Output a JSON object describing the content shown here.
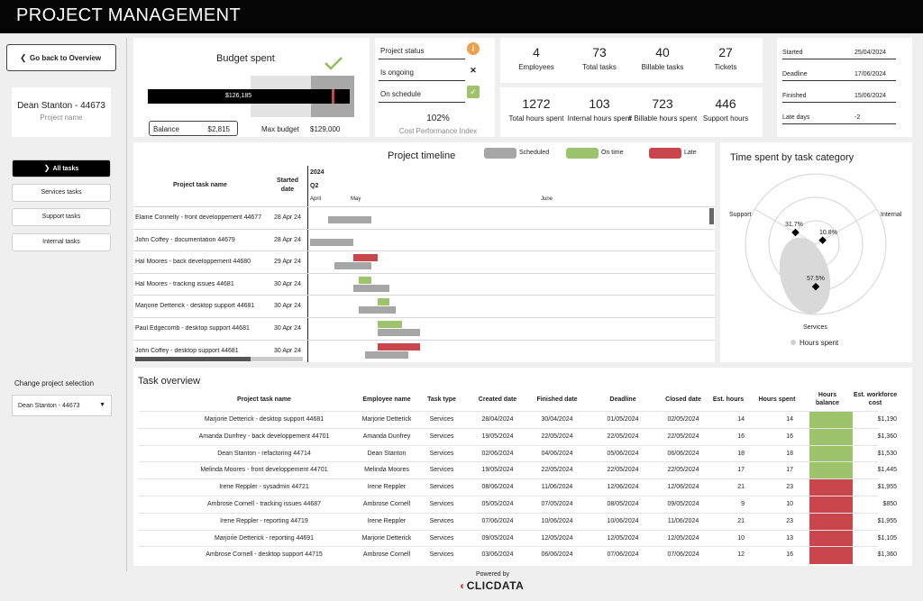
{
  "header": {
    "title": "PROJECT MANAGEMENT"
  },
  "sidebar": {
    "back_label": "Go back to Overview",
    "project_name": "Dean Stanton - 44673",
    "project_name_caption": "Project name",
    "filters": [
      {
        "label": "All tasks",
        "active": true
      },
      {
        "label": "Services tasks",
        "active": false
      },
      {
        "label": "Support tasks",
        "active": false
      },
      {
        "label": "Internal tasks",
        "active": false
      }
    ],
    "change_label": "Change project selection",
    "select_value": "Dean Stanton - 44673"
  },
  "budget": {
    "title": "Budget spent",
    "spent": "$126,185",
    "balance_label": "Balance",
    "balance_value": "$2,815",
    "max_label": "Max budget",
    "max_value": "$129,000",
    "spent_value": 126185,
    "max_number": 129000
  },
  "status": {
    "rows": [
      {
        "label": "Project status",
        "icon": "info-icon"
      },
      {
        "label": "Is ongoing",
        "icon": "cross-icon"
      },
      {
        "label": "On schedule",
        "icon": "check-icon"
      }
    ],
    "cpi_value": "102%",
    "cpi_label": "Cost Performance Index"
  },
  "kpis_top": [
    {
      "value": "4",
      "label": "Employees"
    },
    {
      "value": "73",
      "label": "Total tasks"
    },
    {
      "value": "40",
      "label": "Billable tasks"
    },
    {
      "value": "27",
      "label": "Tickets"
    }
  ],
  "kpis_bottom": [
    {
      "value": "1272",
      "label": "Total hours spent"
    },
    {
      "value": "103",
      "label": "Internal hours spent"
    },
    {
      "value": "723",
      "label": "# Billable hours spent"
    },
    {
      "value": "446",
      "label": "Support hours"
    }
  ],
  "dates": [
    {
      "label": "Started",
      "value": "25/04/2024"
    },
    {
      "label": "Deadline",
      "value": "17/06/2024"
    },
    {
      "label": "Finished",
      "value": "15/06/2024"
    },
    {
      "label": "Late days",
      "value": "-2"
    }
  ],
  "timeline": {
    "title": "Project timeline",
    "legend": [
      {
        "label": "Scheduled",
        "color": "#a6a6a6"
      },
      {
        "label": "On time",
        "color": "#9dc36b"
      },
      {
        "label": "Late",
        "color": "#c9474c"
      }
    ],
    "col_name": "Project task name",
    "col_started": "Started date",
    "year": "2024",
    "quarter": "Q2",
    "months": [
      "April",
      "May",
      "June"
    ],
    "tasks": [
      {
        "name": "Elaine Connelly - front developpement 44677",
        "started": "28 Apr 24",
        "sched": [
          "2024-04-28",
          "2024-05-05"
        ],
        "actual": null,
        "status": ""
      },
      {
        "name": "John Coffey - documentation 44679",
        "started": "28 Apr 24",
        "sched": [
          "2024-04-25",
          "2024-05-02"
        ],
        "actual": null,
        "status": ""
      },
      {
        "name": "Hal Moores - back developpement 44680",
        "started": "29 Apr 24",
        "sched": [
          "2024-04-29",
          "2024-05-05"
        ],
        "actual": [
          "2024-05-02",
          "2024-05-06"
        ],
        "status": "late"
      },
      {
        "name": "Hal Moores - tracking issues 44681",
        "started": "30 Apr 24",
        "sched": [
          "2024-05-02",
          "2024-05-08"
        ],
        "actual": [
          "2024-05-03",
          "2024-05-05"
        ],
        "status": "ontime"
      },
      {
        "name": "Marjorie Detterick - desktop support 44681",
        "started": "30 Apr 24",
        "sched": [
          "2024-05-03",
          "2024-05-09"
        ],
        "actual": [
          "2024-05-06",
          "2024-05-08"
        ],
        "status": "ontime"
      },
      {
        "name": "Paul Edgecomb - desktop support 44681",
        "started": "30 Apr 24",
        "sched": [
          "2024-05-06",
          "2024-05-13"
        ],
        "actual": [
          "2024-05-06",
          "2024-05-10"
        ],
        "status": "ontime"
      },
      {
        "name": "John Coffey - desktop support 44681",
        "started": "30 Apr 24",
        "sched": [
          "2024-05-04",
          "2024-05-11"
        ],
        "actual": [
          "2024-05-06",
          "2024-05-13"
        ],
        "status": "late"
      }
    ]
  },
  "radar": {
    "title": "Time spent by task category",
    "axes": [
      "Support",
      "Internal",
      "Services"
    ],
    "values": [
      "31.7%",
      "10.8%",
      "57.5%"
    ],
    "numbers": [
      31.7,
      10.8,
      57.5
    ],
    "legend": "Hours spent",
    "color": "#d9d9d9"
  },
  "overview": {
    "title": "Task overview",
    "columns": [
      "Project task name",
      "Employee name",
      "Task type",
      "Created date",
      "Finished date",
      "Deadline",
      "Closed date",
      "Est. hours",
      "Hours spent",
      "Hours balance",
      "Est. workforce cost"
    ],
    "rows": [
      {
        "task": "Marjorie Detterick - desktop support 44681",
        "employee": "Marjorie Detterick",
        "type": "Services",
        "created": "28/04/2024",
        "finished": "30/04/2024",
        "deadline": "01/05/2024",
        "closed": "02/05/2024",
        "est": "14",
        "spent": "14",
        "balance": "positive",
        "cost": "$1,190"
      },
      {
        "task": "Amanda Dunfrey - back developpement 44701",
        "employee": "Amanda Dunfrey",
        "type": "Services",
        "created": "19/05/2024",
        "finished": "22/05/2024",
        "deadline": "22/05/2024",
        "closed": "22/05/2024",
        "est": "16",
        "spent": "16",
        "balance": "positive",
        "cost": "$1,360"
      },
      {
        "task": "Dean Stanton - refactoring 44714",
        "employee": "Dean Stanton",
        "type": "Services",
        "created": "02/06/2024",
        "finished": "04/06/2024",
        "deadline": "05/06/2024",
        "closed": "06/06/2024",
        "est": "18",
        "spent": "18",
        "balance": "positive",
        "cost": "$1,530"
      },
      {
        "task": "Melinda Moores - front developpement 44701",
        "employee": "Melinda Moores",
        "type": "Services",
        "created": "19/05/2024",
        "finished": "22/05/2024",
        "deadline": "22/05/2024",
        "closed": "22/05/2024",
        "est": "17",
        "spent": "17",
        "balance": "positive",
        "cost": "$1,445"
      },
      {
        "task": "Irene Reppler - sysadmin 44721",
        "employee": "Irene Reppler",
        "type": "Services",
        "created": "08/06/2024",
        "finished": "11/06/2024",
        "deadline": "12/06/2024",
        "closed": "12/06/2024",
        "est": "21",
        "spent": "23",
        "balance": "negative",
        "cost": "$1,955"
      },
      {
        "task": "Ambrose Cornell - tracking issues 44687",
        "employee": "Ambrose Cornell",
        "type": "Services",
        "created": "05/05/2024",
        "finished": "07/05/2024",
        "deadline": "08/05/2024",
        "closed": "09/05/2024",
        "est": "9",
        "spent": "10",
        "balance": "negative",
        "cost": "$850"
      },
      {
        "task": "Irene Reppler - reporting 44719",
        "employee": "Irene Reppler",
        "type": "Services",
        "created": "07/06/2024",
        "finished": "10/06/2024",
        "deadline": "10/06/2024",
        "closed": "11/06/2024",
        "est": "21",
        "spent": "23",
        "balance": "negative",
        "cost": "$1,955"
      },
      {
        "task": "Marjorie Detterick - reporting 44691",
        "employee": "Marjorie Detterick",
        "type": "Services",
        "created": "09/05/2024",
        "finished": "12/05/2024",
        "deadline": "12/05/2024",
        "closed": "12/05/2024",
        "est": "10",
        "spent": "13",
        "balance": "negative",
        "cost": "$1,105"
      },
      {
        "task": "Ambrose Cornell - desktop support 44715",
        "employee": "Ambrose Cornell",
        "type": "Services",
        "created": "03/06/2024",
        "finished": "06/06/2024",
        "deadline": "07/06/2024",
        "closed": "07/06/2024",
        "est": "12",
        "spent": "16",
        "balance": "negative",
        "cost": "$1,360"
      }
    ]
  },
  "footer": {
    "powered": "Powered by",
    "brand_prefix": "CLIC",
    "brand_suffix": "DATA"
  },
  "colors": {
    "green": "#9dc36b",
    "red": "#c9474c",
    "gray": "#a6a6a6",
    "orange": "#f0a04b"
  }
}
